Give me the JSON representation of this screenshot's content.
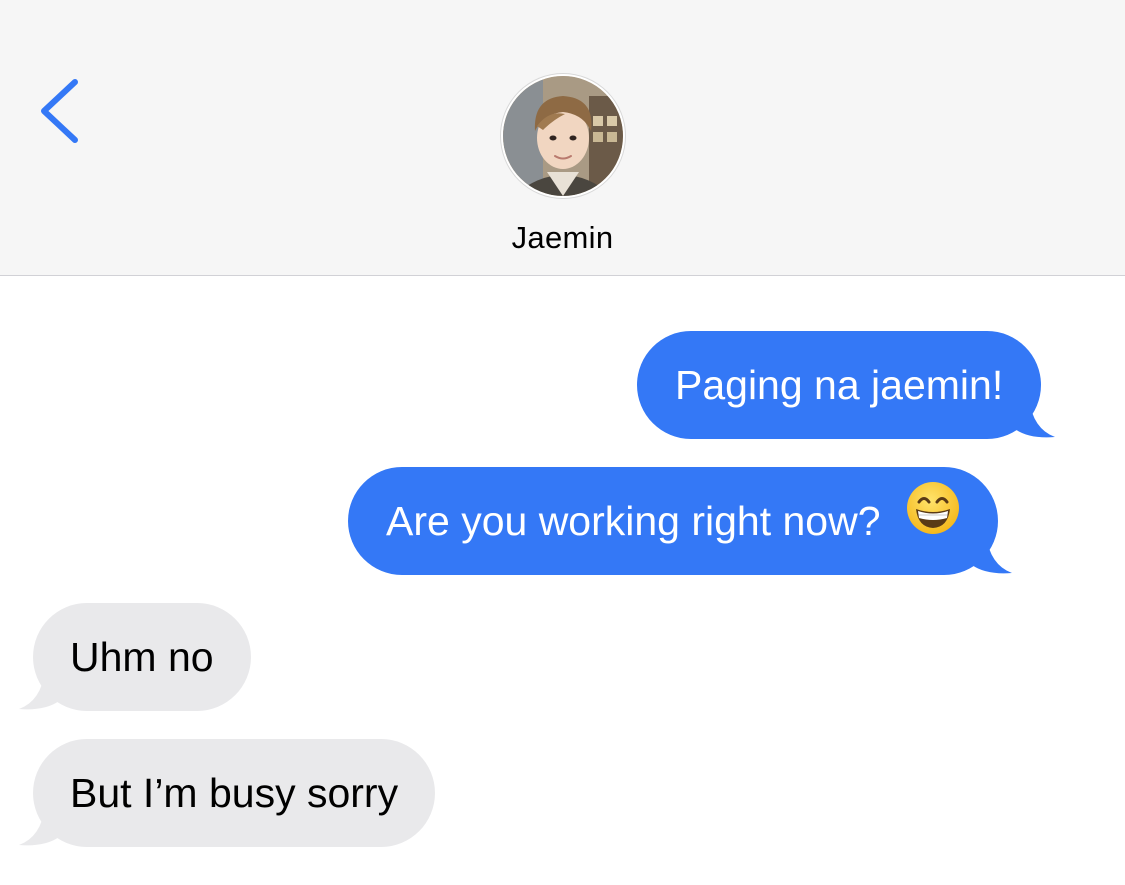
{
  "header": {
    "back_icon": "chevron-left-icon",
    "contact_name": "Jaemin",
    "avatar_icon": "contact-photo"
  },
  "messages": [
    {
      "direction": "sent",
      "text": "Paging na jaemin!"
    },
    {
      "direction": "sent",
      "text": "Are you working right now?",
      "emoji": "grinning-face-with-smiling-eyes-emoji"
    },
    {
      "direction": "received",
      "text": "Uhm no"
    },
    {
      "direction": "received",
      "text": "But I’m busy sorry"
    }
  ],
  "colors": {
    "sent_bubble": "#3478f6",
    "received_bubble": "#e9e9eb",
    "accent": "#3478f6",
    "header_bg": "#f6f6f6"
  }
}
